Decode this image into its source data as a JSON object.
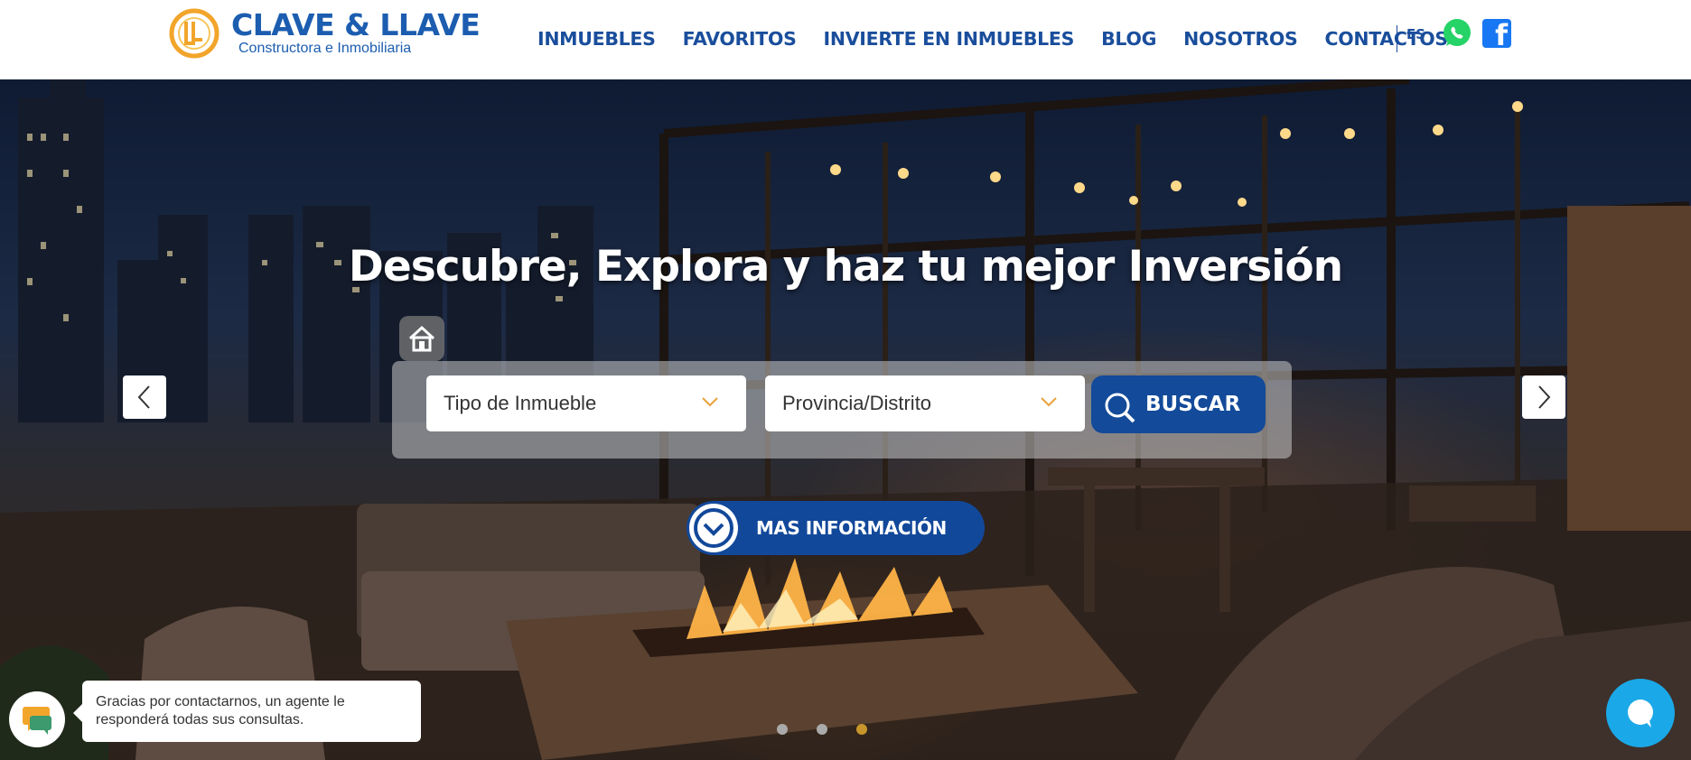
{
  "header": {
    "logo_title": "CLAVE & LLAVE",
    "logo_subtitle": "Constructora e Inmobiliaria",
    "nav": [
      "INMUEBLES",
      "FAVORITOS",
      "INVIERTE EN INMUEBLES",
      "BLOG",
      "NOSOTROS",
      "CONTACTOS"
    ],
    "language": "ES",
    "social_icons": [
      "whatsapp-icon",
      "facebook-icon"
    ],
    "brand_color": "#1a4e9c",
    "logo_accent": "#f2a52b"
  },
  "hero": {
    "headline": "Descubre, Explora y haz tu mejor Inversión",
    "search": {
      "property_type": "Tipo de Inmueble",
      "location": "Provincia/Distrito",
      "button": "BUSCAR"
    },
    "more_info": "MAS INFORMACIÓN",
    "slides_total": 3,
    "active_slide": 3
  },
  "chat": {
    "message": "Gracias por contactarnos, un agente le responderá todas sus consultas."
  },
  "colors": {
    "button_blue": "#134a9a",
    "active_dot": "#c8962a",
    "live_chat": "#1ba8e8"
  }
}
